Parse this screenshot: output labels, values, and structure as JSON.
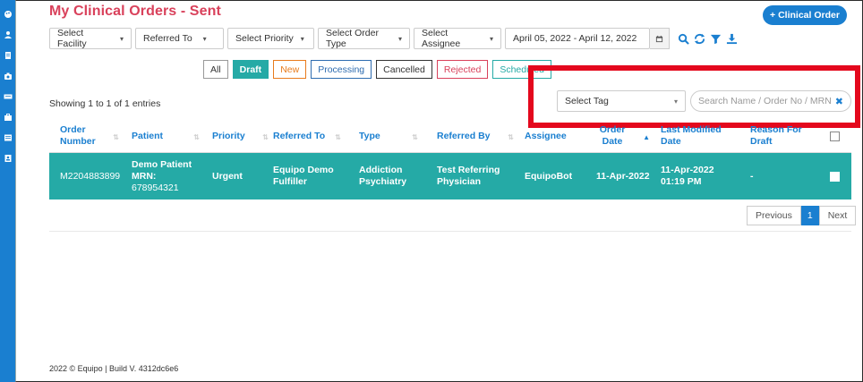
{
  "header": {
    "title": "My Clinical Orders - Sent",
    "add_button": "+ Clinical Order"
  },
  "filters": {
    "facility": "Select Facility",
    "referred_to": "Referred To",
    "priority": "Select Priority",
    "order_type": "Select Order Type",
    "assignee": "Select Assignee",
    "date_range": "April 05, 2022 - April 12, 2022"
  },
  "status_tabs": [
    {
      "label": "All",
      "color": "#333333"
    },
    {
      "label": "Draft",
      "color": "#ffffff",
      "active": true
    },
    {
      "label": "New",
      "color": "#e87b1c"
    },
    {
      "label": "Processing",
      "color": "#2e6cb0"
    },
    {
      "label": "Cancelled",
      "color": "#333333"
    },
    {
      "label": "Rejected",
      "color": "#d9415b"
    },
    {
      "label": "Scheduled",
      "color": "#25aaa6"
    }
  ],
  "table": {
    "showing": "Showing 1 to 1 of 1 entries",
    "tag_select": "Select Tag",
    "search_placeholder": "Search Name / Order No / MRN",
    "columns": [
      "Order Number",
      "Patient",
      "Priority",
      "Referred To",
      "Type",
      "Referred By",
      "Assignee",
      "Order Date",
      "Last Modified Date",
      "Reason For Draft"
    ],
    "rows": [
      {
        "order_number": "M2204883899",
        "patient_name": "Demo Patient",
        "patient_mrn_label": "MRN:",
        "patient_mrn": "678954321",
        "priority": "Urgent",
        "referred_to": "Equipo Demo Fulfiller",
        "type": "Addiction Psychiatry",
        "referred_by": "Test Referring Physician",
        "assignee": "EquipoBot",
        "order_date": "11-Apr-2022",
        "last_modified": "11-Apr-2022 01:19 PM",
        "reason": "-"
      }
    ]
  },
  "pagination": {
    "previous": "Previous",
    "current": "1",
    "next": "Next"
  },
  "footer": "2022 © Equipo | Build V. 4312dc6e6",
  "colors": {
    "brand_blue": "#1a7fd0",
    "teal": "#25aaa6",
    "title_red": "#d9415b",
    "highlight_red": "#e4081d"
  }
}
